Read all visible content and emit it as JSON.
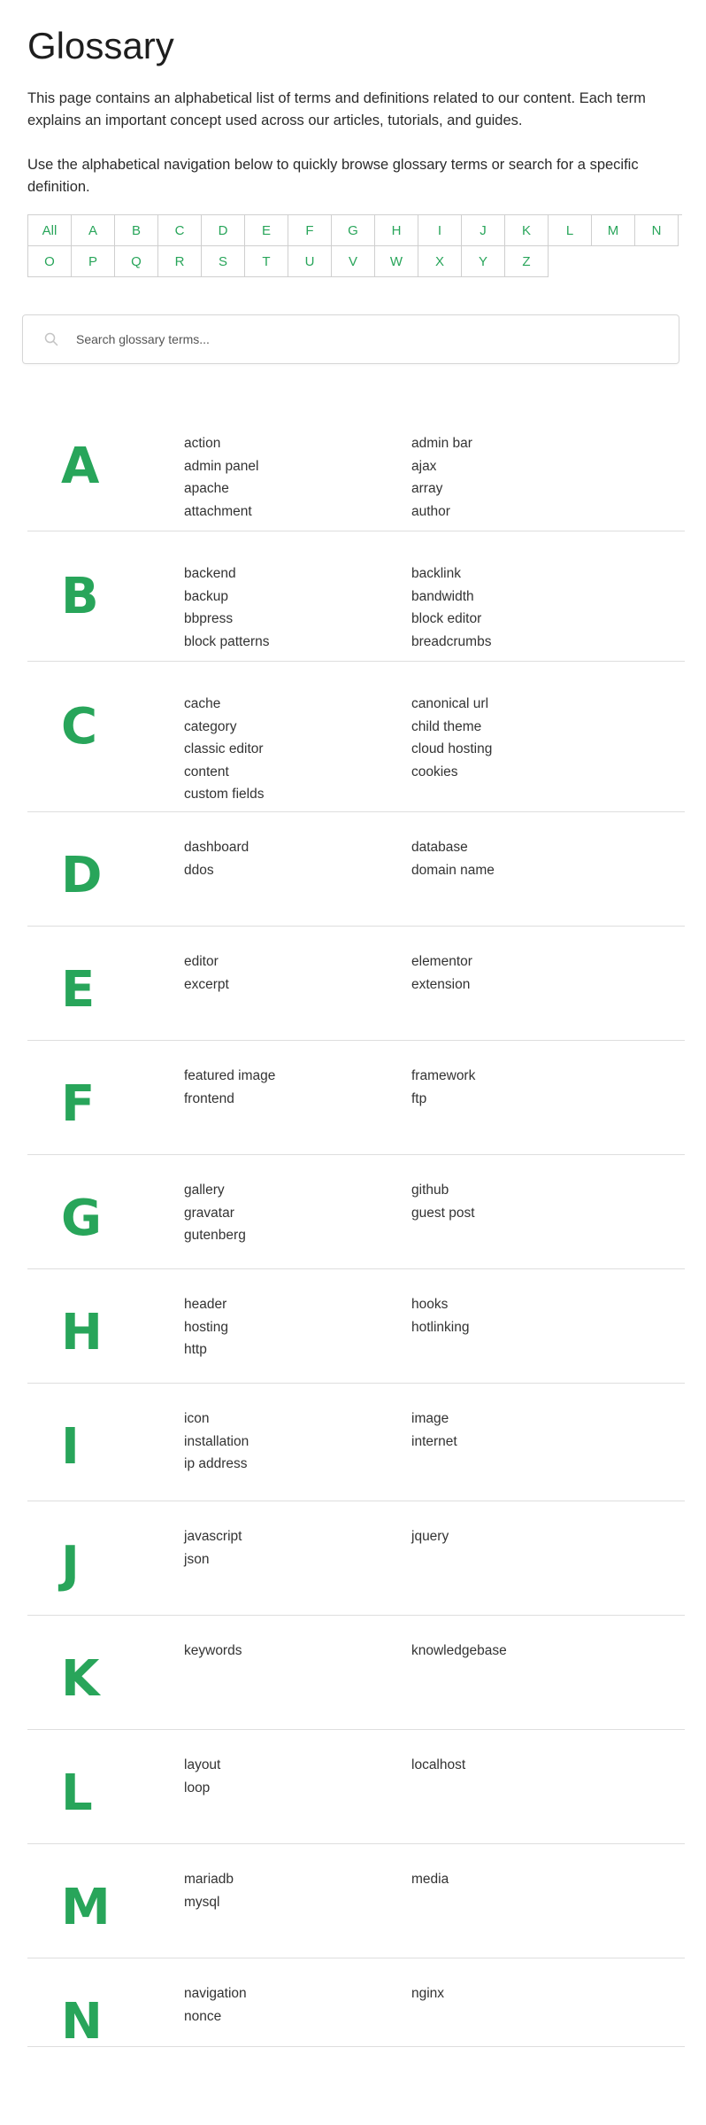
{
  "page": {
    "title": "Glossary",
    "intro1": "This page contains an alphabetical list of terms and definitions related to our content. Each term explains an important concept used across our articles, tutorials, and guides.",
    "intro2": "Use the alphabetical navigation below to quickly browse glossary terms or search for a specific definition."
  },
  "nav": {
    "all": "All",
    "letters_row1": [
      "A",
      "B",
      "C",
      "D",
      "E",
      "F",
      "G",
      "H",
      "I",
      "J",
      "K",
      "L",
      "M",
      "N"
    ],
    "letters_row2": [
      "O",
      "P",
      "Q",
      "R",
      "S",
      "T",
      "U",
      "V",
      "W",
      "X",
      "Y",
      "Z"
    ]
  },
  "search": {
    "placeholder": "Search glossary terms...",
    "icon": "search-icon"
  },
  "colors": {
    "accent": "#28a55a",
    "border": "#cfcfcf",
    "text": "#2a2a2a"
  },
  "sections": [
    {
      "letter": "A",
      "terms": [
        "action",
        "admin bar",
        "admin panel",
        "ajax",
        "apache",
        "array",
        "attachment",
        "author"
      ]
    },
    {
      "letter": "B",
      "terms": [
        "backend",
        "backlink",
        "backup",
        "bandwidth",
        "bbpress",
        "block editor",
        "block patterns",
        "breadcrumbs"
      ]
    },
    {
      "letter": "C",
      "terms": [
        "cache",
        "canonical url",
        "category",
        "child theme",
        "classic editor",
        "cloud hosting",
        "content",
        "cookies",
        "custom fields"
      ]
    },
    {
      "letter": "D",
      "terms": [
        "dashboard",
        "database",
        "ddos",
        "domain name"
      ]
    },
    {
      "letter": "E",
      "terms": [
        "editor",
        "elementor",
        "excerpt",
        "extension"
      ]
    },
    {
      "letter": "F",
      "terms": [
        "featured image",
        "framework",
        "frontend",
        "ftp"
      ]
    },
    {
      "letter": "G",
      "terms": [
        "gallery",
        "github",
        "gravatar",
        "guest post",
        "gutenberg"
      ]
    },
    {
      "letter": "H",
      "terms": [
        "header",
        "hooks",
        "hosting",
        "hotlinking",
        "http"
      ]
    },
    {
      "letter": "I",
      "terms": [
        "icon",
        "image",
        "installation",
        "internet",
        "ip address"
      ]
    },
    {
      "letter": "J",
      "terms": [
        "javascript",
        "jquery",
        "json"
      ]
    },
    {
      "letter": "K",
      "terms": [
        "keywords",
        "knowledgebase"
      ]
    },
    {
      "letter": "L",
      "terms": [
        "layout",
        "localhost",
        "loop"
      ]
    },
    {
      "letter": "M",
      "terms": [
        "mariadb",
        "media",
        "mysql"
      ]
    },
    {
      "letter": "N",
      "terms": [
        "navigation",
        "nginx",
        "nonce"
      ]
    }
  ]
}
